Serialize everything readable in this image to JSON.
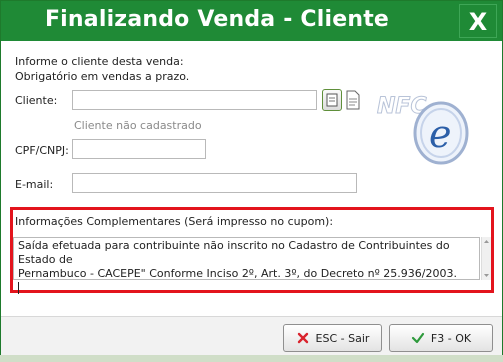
{
  "dialog": {
    "title": "Finalizando Venda - Cliente",
    "close_label": "X"
  },
  "form": {
    "intro_line1": "Informe o cliente desta venda:",
    "intro_line2": "Obrigatório em vendas a prazo.",
    "cliente_label": "Cliente:",
    "cliente_value": "",
    "cliente_status": "Cliente não cadastrado",
    "cpf_label": "CPF/CNPJ:",
    "cpf_value": "",
    "email_label": "E-mail:",
    "email_value": ""
  },
  "info": {
    "label": "Informações Complementares (Será impresso no cupom):",
    "text_line1": "Saída efetuada para contribuinte não inscrito no Cadastro de Contribuintes do Estado de",
    "text_line2": "Pernambuco - CACEPE\" Conforme Inciso 2º, Art. 3º, do Decreto nº 25.936/2003."
  },
  "buttons": {
    "cancel_label": "ESC - Sair",
    "ok_label": "F3 - OK"
  },
  "logo": {
    "text": "NFC",
    "letter": "e"
  },
  "colors": {
    "titlebar": "#1f8a36",
    "highlight_border": "#e3141d",
    "cancel_icon": "#d9232d",
    "ok_icon": "#2e9a3c"
  }
}
